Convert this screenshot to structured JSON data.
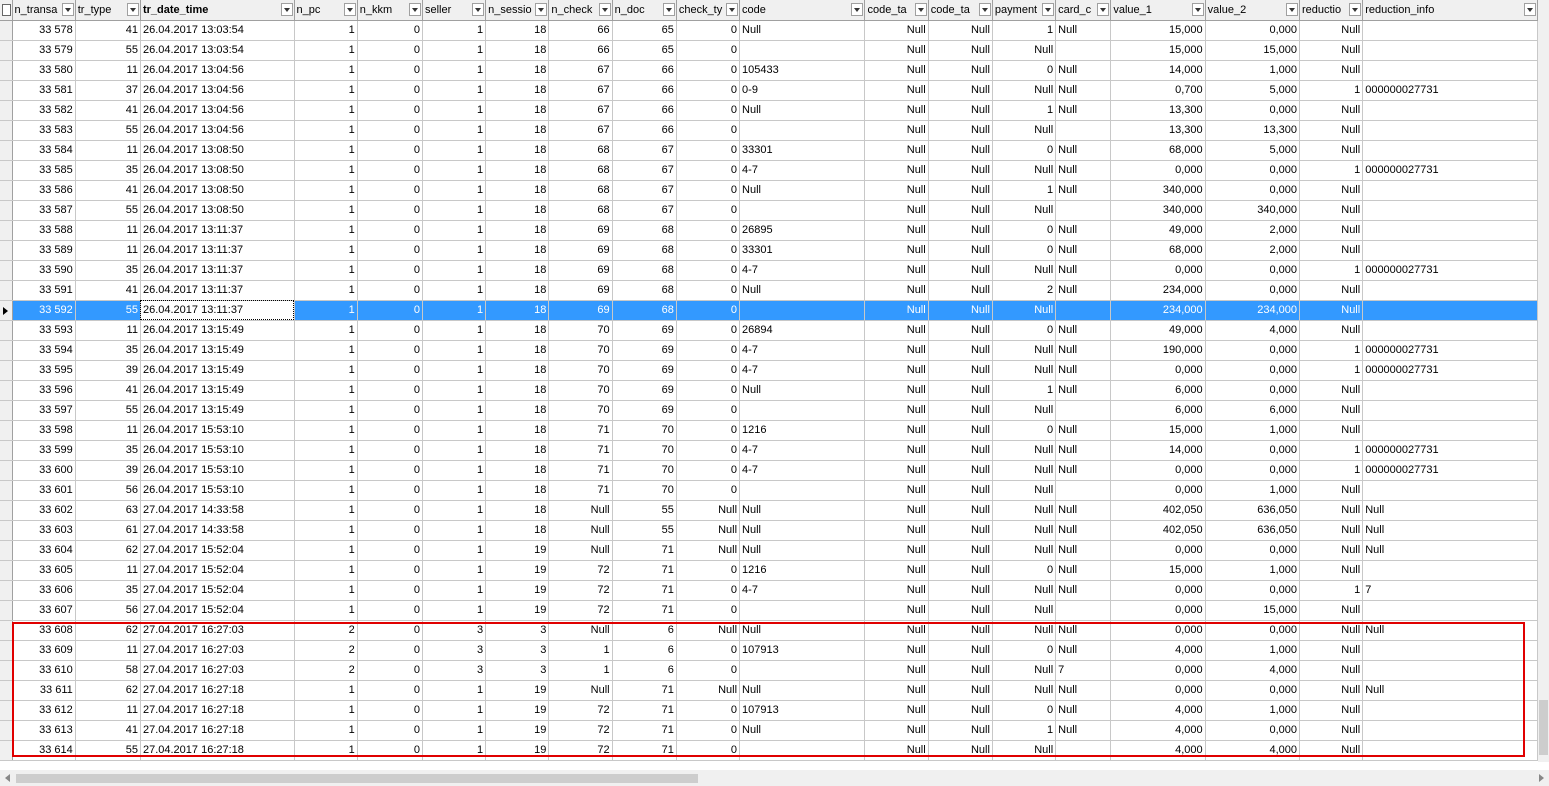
{
  "columns": [
    {
      "label": "n_transa",
      "bold": false
    },
    {
      "label": "tr_type",
      "bold": false
    },
    {
      "label": "tr_date_time",
      "bold": true
    },
    {
      "label": "n_pc",
      "bold": false
    },
    {
      "label": "n_kkm",
      "bold": false
    },
    {
      "label": "seller",
      "bold": false
    },
    {
      "label": "n_sessio",
      "bold": false
    },
    {
      "label": "n_check",
      "bold": false
    },
    {
      "label": "n_doc",
      "bold": false
    },
    {
      "label": "check_ty",
      "bold": false
    },
    {
      "label": "code",
      "bold": false
    },
    {
      "label": "code_ta",
      "bold": false
    },
    {
      "label": "code_ta",
      "bold": false
    },
    {
      "label": "payment",
      "bold": false
    },
    {
      "label": "card_c",
      "bold": false
    },
    {
      "label": "value_1",
      "bold": false
    },
    {
      "label": "value_2",
      "bold": false
    },
    {
      "label": "reductio",
      "bold": false
    },
    {
      "label": "reduction_info",
      "bold": false
    }
  ],
  "selected_row": 14,
  "highlight_rows": [
    30,
    36
  ],
  "rows": [
    [
      "33 578",
      "41",
      "26.04.2017 13:03:54",
      "1",
      "0",
      "1",
      "18",
      "66",
      "65",
      "0",
      "Null",
      "Null",
      "Null",
      "1",
      "Null",
      "15,000",
      "0,000",
      "Null",
      ""
    ],
    [
      "33 579",
      "55",
      "26.04.2017 13:03:54",
      "1",
      "0",
      "1",
      "18",
      "66",
      "65",
      "0",
      "",
      "Null",
      "Null",
      "Null",
      "",
      "15,000",
      "15,000",
      "Null",
      ""
    ],
    [
      "33 580",
      "11",
      "26.04.2017 13:04:56",
      "1",
      "0",
      "1",
      "18",
      "67",
      "66",
      "0",
      "105433",
      "Null",
      "Null",
      "0",
      "Null",
      "14,000",
      "1,000",
      "Null",
      ""
    ],
    [
      "33 581",
      "37",
      "26.04.2017 13:04:56",
      "1",
      "0",
      "1",
      "18",
      "67",
      "66",
      "0",
      "0-9",
      "Null",
      "Null",
      "Null",
      "Null",
      "0,700",
      "5,000",
      "1",
      "000000027731"
    ],
    [
      "33 582",
      "41",
      "26.04.2017 13:04:56",
      "1",
      "0",
      "1",
      "18",
      "67",
      "66",
      "0",
      "Null",
      "Null",
      "Null",
      "1",
      "Null",
      "13,300",
      "0,000",
      "Null",
      ""
    ],
    [
      "33 583",
      "55",
      "26.04.2017 13:04:56",
      "1",
      "0",
      "1",
      "18",
      "67",
      "66",
      "0",
      "",
      "Null",
      "Null",
      "Null",
      "",
      "13,300",
      "13,300",
      "Null",
      ""
    ],
    [
      "33 584",
      "11",
      "26.04.2017 13:08:50",
      "1",
      "0",
      "1",
      "18",
      "68",
      "67",
      "0",
      "33301",
      "Null",
      "Null",
      "0",
      "Null",
      "68,000",
      "5,000",
      "Null",
      ""
    ],
    [
      "33 585",
      "35",
      "26.04.2017 13:08:50",
      "1",
      "0",
      "1",
      "18",
      "68",
      "67",
      "0",
      "4-7",
      "Null",
      "Null",
      "Null",
      "Null",
      "0,000",
      "0,000",
      "1",
      "000000027731"
    ],
    [
      "33 586",
      "41",
      "26.04.2017 13:08:50",
      "1",
      "0",
      "1",
      "18",
      "68",
      "67",
      "0",
      "Null",
      "Null",
      "Null",
      "1",
      "Null",
      "340,000",
      "0,000",
      "Null",
      ""
    ],
    [
      "33 587",
      "55",
      "26.04.2017 13:08:50",
      "1",
      "0",
      "1",
      "18",
      "68",
      "67",
      "0",
      "",
      "Null",
      "Null",
      "Null",
      "",
      "340,000",
      "340,000",
      "Null",
      ""
    ],
    [
      "33 588",
      "11",
      "26.04.2017 13:11:37",
      "1",
      "0",
      "1",
      "18",
      "69",
      "68",
      "0",
      "26895",
      "Null",
      "Null",
      "0",
      "Null",
      "49,000",
      "2,000",
      "Null",
      ""
    ],
    [
      "33 589",
      "11",
      "26.04.2017 13:11:37",
      "1",
      "0",
      "1",
      "18",
      "69",
      "68",
      "0",
      "33301",
      "Null",
      "Null",
      "0",
      "Null",
      "68,000",
      "2,000",
      "Null",
      ""
    ],
    [
      "33 590",
      "35",
      "26.04.2017 13:11:37",
      "1",
      "0",
      "1",
      "18",
      "69",
      "68",
      "0",
      "4-7",
      "Null",
      "Null",
      "Null",
      "Null",
      "0,000",
      "0,000",
      "1",
      "000000027731"
    ],
    [
      "33 591",
      "41",
      "26.04.2017 13:11:37",
      "1",
      "0",
      "1",
      "18",
      "69",
      "68",
      "0",
      "Null",
      "Null",
      "Null",
      "2",
      "Null",
      "234,000",
      "0,000",
      "Null",
      ""
    ],
    [
      "33 592",
      "55",
      "26.04.2017 13:11:37",
      "1",
      "0",
      "1",
      "18",
      "69",
      "68",
      "0",
      "",
      "Null",
      "Null",
      "Null",
      "",
      "234,000",
      "234,000",
      "Null",
      ""
    ],
    [
      "33 593",
      "11",
      "26.04.2017 13:15:49",
      "1",
      "0",
      "1",
      "18",
      "70",
      "69",
      "0",
      "26894",
      "Null",
      "Null",
      "0",
      "Null",
      "49,000",
      "4,000",
      "Null",
      ""
    ],
    [
      "33 594",
      "35",
      "26.04.2017 13:15:49",
      "1",
      "0",
      "1",
      "18",
      "70",
      "69",
      "0",
      "4-7",
      "Null",
      "Null",
      "Null",
      "Null",
      "190,000",
      "0,000",
      "1",
      "000000027731"
    ],
    [
      "33 595",
      "39",
      "26.04.2017 13:15:49",
      "1",
      "0",
      "1",
      "18",
      "70",
      "69",
      "0",
      "4-7",
      "Null",
      "Null",
      "Null",
      "Null",
      "0,000",
      "0,000",
      "1",
      "000000027731"
    ],
    [
      "33 596",
      "41",
      "26.04.2017 13:15:49",
      "1",
      "0",
      "1",
      "18",
      "70",
      "69",
      "0",
      "Null",
      "Null",
      "Null",
      "1",
      "Null",
      "6,000",
      "0,000",
      "Null",
      ""
    ],
    [
      "33 597",
      "55",
      "26.04.2017 13:15:49",
      "1",
      "0",
      "1",
      "18",
      "70",
      "69",
      "0",
      "",
      "Null",
      "Null",
      "Null",
      "",
      "6,000",
      "6,000",
      "Null",
      ""
    ],
    [
      "33 598",
      "11",
      "26.04.2017 15:53:10",
      "1",
      "0",
      "1",
      "18",
      "71",
      "70",
      "0",
      "1216",
      "Null",
      "Null",
      "0",
      "Null",
      "15,000",
      "1,000",
      "Null",
      ""
    ],
    [
      "33 599",
      "35",
      "26.04.2017 15:53:10",
      "1",
      "0",
      "1",
      "18",
      "71",
      "70",
      "0",
      "4-7",
      "Null",
      "Null",
      "Null",
      "Null",
      "14,000",
      "0,000",
      "1",
      "000000027731"
    ],
    [
      "33 600",
      "39",
      "26.04.2017 15:53:10",
      "1",
      "0",
      "1",
      "18",
      "71",
      "70",
      "0",
      "4-7",
      "Null",
      "Null",
      "Null",
      "Null",
      "0,000",
      "0,000",
      "1",
      "000000027731"
    ],
    [
      "33 601",
      "56",
      "26.04.2017 15:53:10",
      "1",
      "0",
      "1",
      "18",
      "71",
      "70",
      "0",
      "",
      "Null",
      "Null",
      "Null",
      "",
      "0,000",
      "1,000",
      "Null",
      ""
    ],
    [
      "33 602",
      "63",
      "27.04.2017 14:33:58",
      "1",
      "0",
      "1",
      "18",
      "Null",
      "55",
      "Null",
      "Null",
      "Null",
      "Null",
      "Null",
      "Null",
      "402,050",
      "636,050",
      "Null",
      "Null"
    ],
    [
      "33 603",
      "61",
      "27.04.2017 14:33:58",
      "1",
      "0",
      "1",
      "18",
      "Null",
      "55",
      "Null",
      "Null",
      "Null",
      "Null",
      "Null",
      "Null",
      "402,050",
      "636,050",
      "Null",
      "Null"
    ],
    [
      "33 604",
      "62",
      "27.04.2017 15:52:04",
      "1",
      "0",
      "1",
      "19",
      "Null",
      "71",
      "Null",
      "Null",
      "Null",
      "Null",
      "Null",
      "Null",
      "0,000",
      "0,000",
      "Null",
      "Null"
    ],
    [
      "33 605",
      "11",
      "27.04.2017 15:52:04",
      "1",
      "0",
      "1",
      "19",
      "72",
      "71",
      "0",
      "1216",
      "Null",
      "Null",
      "0",
      "Null",
      "15,000",
      "1,000",
      "Null",
      ""
    ],
    [
      "33 606",
      "35",
      "27.04.2017 15:52:04",
      "1",
      "0",
      "1",
      "19",
      "72",
      "71",
      "0",
      "4-7",
      "Null",
      "Null",
      "Null",
      "Null",
      "0,000",
      "0,000",
      "1",
      "7"
    ],
    [
      "33 607",
      "56",
      "27.04.2017 15:52:04",
      "1",
      "0",
      "1",
      "19",
      "72",
      "71",
      "0",
      "",
      "Null",
      "Null",
      "Null",
      "",
      "0,000",
      "15,000",
      "Null",
      ""
    ],
    [
      "33 608",
      "62",
      "27.04.2017 16:27:03",
      "2",
      "0",
      "3",
      "3",
      "Null",
      "6",
      "Null",
      "Null",
      "Null",
      "Null",
      "Null",
      "Null",
      "0,000",
      "0,000",
      "Null",
      "Null"
    ],
    [
      "33 609",
      "11",
      "27.04.2017 16:27:03",
      "2",
      "0",
      "3",
      "3",
      "1",
      "6",
      "0",
      "107913",
      "Null",
      "Null",
      "0",
      "Null",
      "4,000",
      "1,000",
      "Null",
      ""
    ],
    [
      "33 610",
      "58",
      "27.04.2017 16:27:03",
      "2",
      "0",
      "3",
      "3",
      "1",
      "6",
      "0",
      "",
      "Null",
      "Null",
      "Null",
      "7",
      "0,000",
      "4,000",
      "Null",
      ""
    ],
    [
      "33 611",
      "62",
      "27.04.2017 16:27:18",
      "1",
      "0",
      "1",
      "19",
      "Null",
      "71",
      "Null",
      "Null",
      "Null",
      "Null",
      "Null",
      "Null",
      "0,000",
      "0,000",
      "Null",
      "Null"
    ],
    [
      "33 612",
      "11",
      "27.04.2017 16:27:18",
      "1",
      "0",
      "1",
      "19",
      "72",
      "71",
      "0",
      "107913",
      "Null",
      "Null",
      "0",
      "Null",
      "4,000",
      "1,000",
      "Null",
      ""
    ],
    [
      "33 613",
      "41",
      "27.04.2017 16:27:18",
      "1",
      "0",
      "1",
      "19",
      "72",
      "71",
      "0",
      "Null",
      "Null",
      "Null",
      "1",
      "Null",
      "4,000",
      "0,000",
      "Null",
      ""
    ],
    [
      "33 614",
      "55",
      "27.04.2017 16:27:18",
      "1",
      "0",
      "1",
      "19",
      "72",
      "71",
      "0",
      "",
      "Null",
      "Null",
      "Null",
      "",
      "4,000",
      "4,000",
      "Null",
      ""
    ]
  ]
}
